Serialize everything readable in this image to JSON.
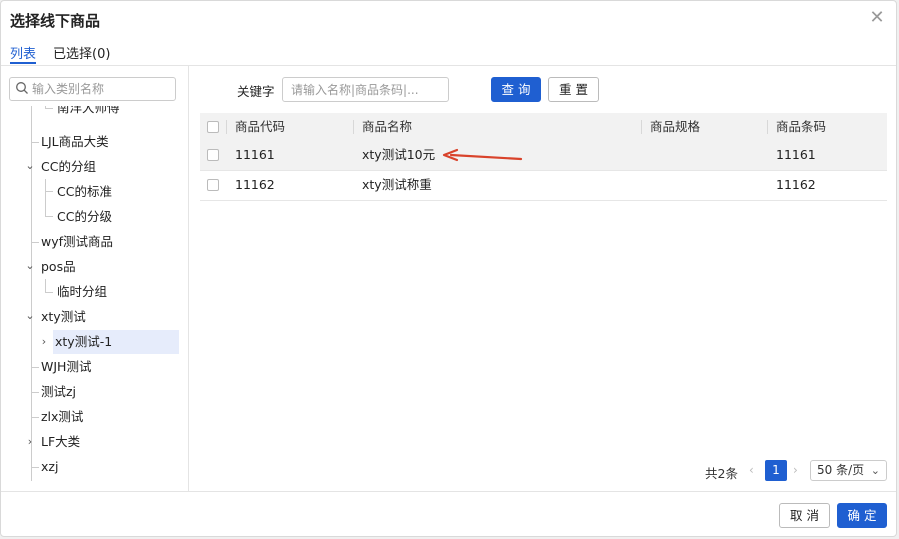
{
  "dialog": {
    "title": "选择线下商品"
  },
  "tabs": {
    "list": "列表",
    "selected": "已选择(0)"
  },
  "sidebar": {
    "search_placeholder": "输入类别名称",
    "tree": [
      {
        "label": "南洋大师傅"
      },
      {
        "label": "LJL商品大类"
      },
      {
        "label": "CC的分组"
      },
      {
        "label": "CC的标准"
      },
      {
        "label": "CC的分级"
      },
      {
        "label": "wyf测试商品"
      },
      {
        "label": "pos品"
      },
      {
        "label": "临时分组"
      },
      {
        "label": "xty测试"
      },
      {
        "label": "xty测试-1"
      },
      {
        "label": "WJH测试"
      },
      {
        "label": "测试zj"
      },
      {
        "label": "zlx测试"
      },
      {
        "label": "LF大类"
      },
      {
        "label": "xzj"
      }
    ]
  },
  "filter": {
    "keyword_label": "关键字",
    "keyword_placeholder": "请输入名称|商品条码|...",
    "search_button": "查 询",
    "reset_button": "重 置"
  },
  "table": {
    "headers": [
      "商品代码",
      "商品名称",
      "商品规格",
      "商品条码"
    ],
    "rows": [
      {
        "code": "11161",
        "name": "xty测试10元",
        "spec": "",
        "barcode": "11161"
      },
      {
        "code": "11162",
        "name": "xty测试称重",
        "spec": "",
        "barcode": "11162"
      }
    ]
  },
  "pagination": {
    "total": "共2条",
    "current_page": "1",
    "page_size": "50 条/页"
  },
  "footer": {
    "cancel": "取 消",
    "confirm": "确 定"
  },
  "colors": {
    "accent": "#1f5fd1",
    "annotation_arrow": "#d9432b"
  },
  "icons": [
    "close-icon",
    "search-icon",
    "chevron-down-icon",
    "chevron-right-icon",
    "chevron-left-icon"
  ]
}
